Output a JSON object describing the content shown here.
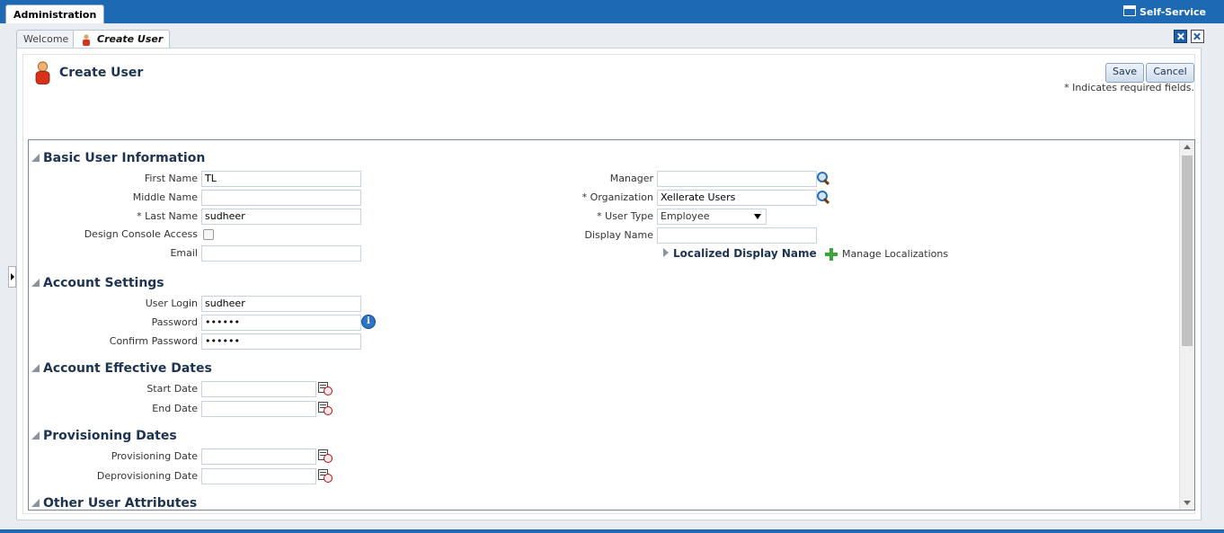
{
  "topbar": {
    "admin_tab": "Administration",
    "self_service": "Self-Service"
  },
  "tabs": {
    "welcome": "Welcome",
    "create_user": "Create User"
  },
  "page": {
    "title": "Create User",
    "save": "Save",
    "cancel": "Cancel",
    "required_note": "* Indicates required fields."
  },
  "sections": {
    "basic": "Basic User Information",
    "account": "Account Settings",
    "effective": "Account Effective Dates",
    "provisioning": "Provisioning Dates",
    "other": "Other User Attributes"
  },
  "basic": {
    "first_name_label": "First Name",
    "first_name": "TL",
    "middle_name_label": "Middle Name",
    "middle_name": "",
    "last_name_label": "* Last Name",
    "last_name": "sudheer",
    "design_console_label": "Design Console Access",
    "email_label": "Email",
    "email": "",
    "manager_label": "Manager",
    "manager": "",
    "organization_label": "* Organization",
    "organization": "Xellerate Users",
    "user_type_label": "* User Type",
    "user_type": "Employee",
    "display_name_label": "Display Name",
    "display_name": "",
    "localized_display_name": "Localized Display Name",
    "manage_localizations": "Manage Localizations"
  },
  "account": {
    "user_login_label": "User Login",
    "user_login": "sudheer",
    "password_label": "Password",
    "password": "••••••",
    "confirm_password_label": "Confirm Password",
    "confirm_password": "••••••"
  },
  "effective": {
    "start_date_label": "Start Date",
    "start_date": "",
    "end_date_label": "End Date",
    "end_date": ""
  },
  "provisioning": {
    "provisioning_date_label": "Provisioning Date",
    "provisioning_date": "",
    "deprovisioning_date_label": "Deprovisioning Date",
    "deprovisioning_date": ""
  },
  "colors": {
    "brand_blue": "#1e69b3",
    "heading": "#1c3352",
    "add_green": "#3aa53a"
  },
  "icons": [
    "user-icon",
    "search-icon",
    "info-icon",
    "calendar-icon",
    "plus-icon",
    "close-tab-icon",
    "close-all-tabs-icon",
    "self-service-icon"
  ]
}
